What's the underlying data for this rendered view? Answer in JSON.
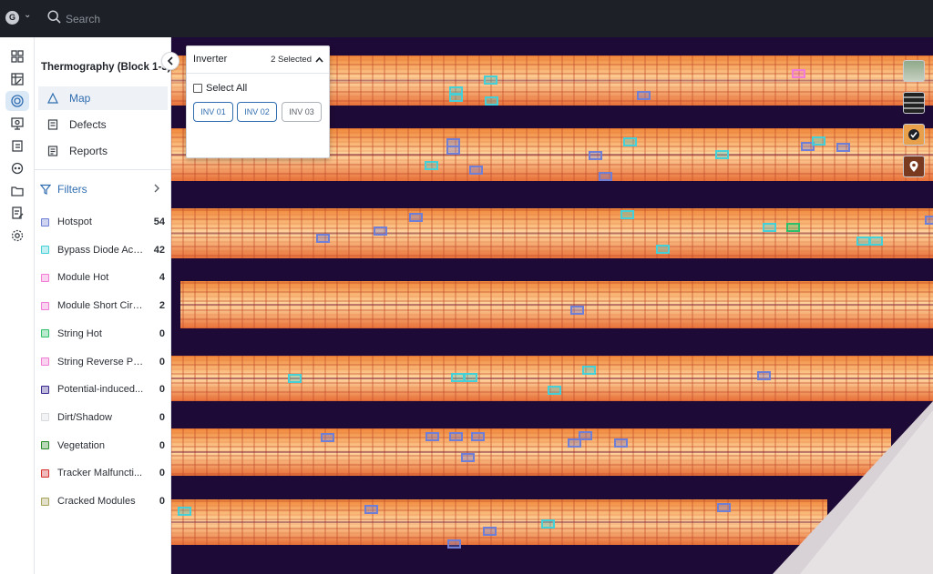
{
  "header": {
    "avatar_initial": "G",
    "search_placeholder": "Search"
  },
  "rail": {
    "icons": [
      "dashboard-icon",
      "image-grid-icon",
      "solar-icon",
      "monitor-icon",
      "clipboard-icon",
      "chat-icon",
      "folder-icon",
      "edit-doc-icon",
      "settings-icon"
    ],
    "active_index": 2
  },
  "panel": {
    "title": "Thermography (Block 1-3)",
    "nav": [
      {
        "label": "Map",
        "icon": "map-icon",
        "active": true
      },
      {
        "label": "Defects",
        "icon": "defects-icon",
        "active": false
      },
      {
        "label": "Reports",
        "icon": "reports-icon",
        "active": false
      }
    ],
    "filters_label": "Filters",
    "categories": [
      {
        "label": "Hotspot",
        "count": "54",
        "color": "#6f7fd6"
      },
      {
        "label": "Bypass Diode Acti...",
        "count": "42",
        "color": "#45d0d8"
      },
      {
        "label": "Module Hot",
        "count": "4",
        "color": "#f07cd6"
      },
      {
        "label": "Module Short Circ...",
        "count": "2",
        "color": "#f07cd6"
      },
      {
        "label": "String Hot",
        "count": "0",
        "color": "#2fbf6a"
      },
      {
        "label": "String Reverse Po...",
        "count": "0",
        "color": "#f07cd6"
      },
      {
        "label": "Potential-induced...",
        "count": "0",
        "color": "#3b2a8f"
      },
      {
        "label": "Dirt/Shadow",
        "count": "0",
        "color": "#d8dadd"
      },
      {
        "label": "Vegetation",
        "count": "0",
        "color": "#2a8a2a"
      },
      {
        "label": "Tracker Malfuncti...",
        "count": "0",
        "color": "#d43030"
      },
      {
        "label": "Cracked Modules",
        "count": "0",
        "color": "#a8a35a"
      }
    ]
  },
  "inverter": {
    "title": "Inverter",
    "selected_text": "2 Selected",
    "select_all_label": "Select All",
    "options": [
      {
        "label": "INV 01",
        "selected": true
      },
      {
        "label": "INV 02",
        "selected": true
      },
      {
        "label": "INV 03",
        "selected": false
      }
    ]
  },
  "map_layers": [
    "rgb-layer-icon",
    "grayscale-layer-icon",
    "defect-layer-icon",
    "marker-layer-icon"
  ],
  "colors": {
    "accent": "#2f6db0",
    "topbar": "#1d2127",
    "hotspot": "#6f7fd6",
    "bypass": "#45d0d8",
    "module_hot": "#f07cd6",
    "string_hot": "#2fbf6a"
  }
}
